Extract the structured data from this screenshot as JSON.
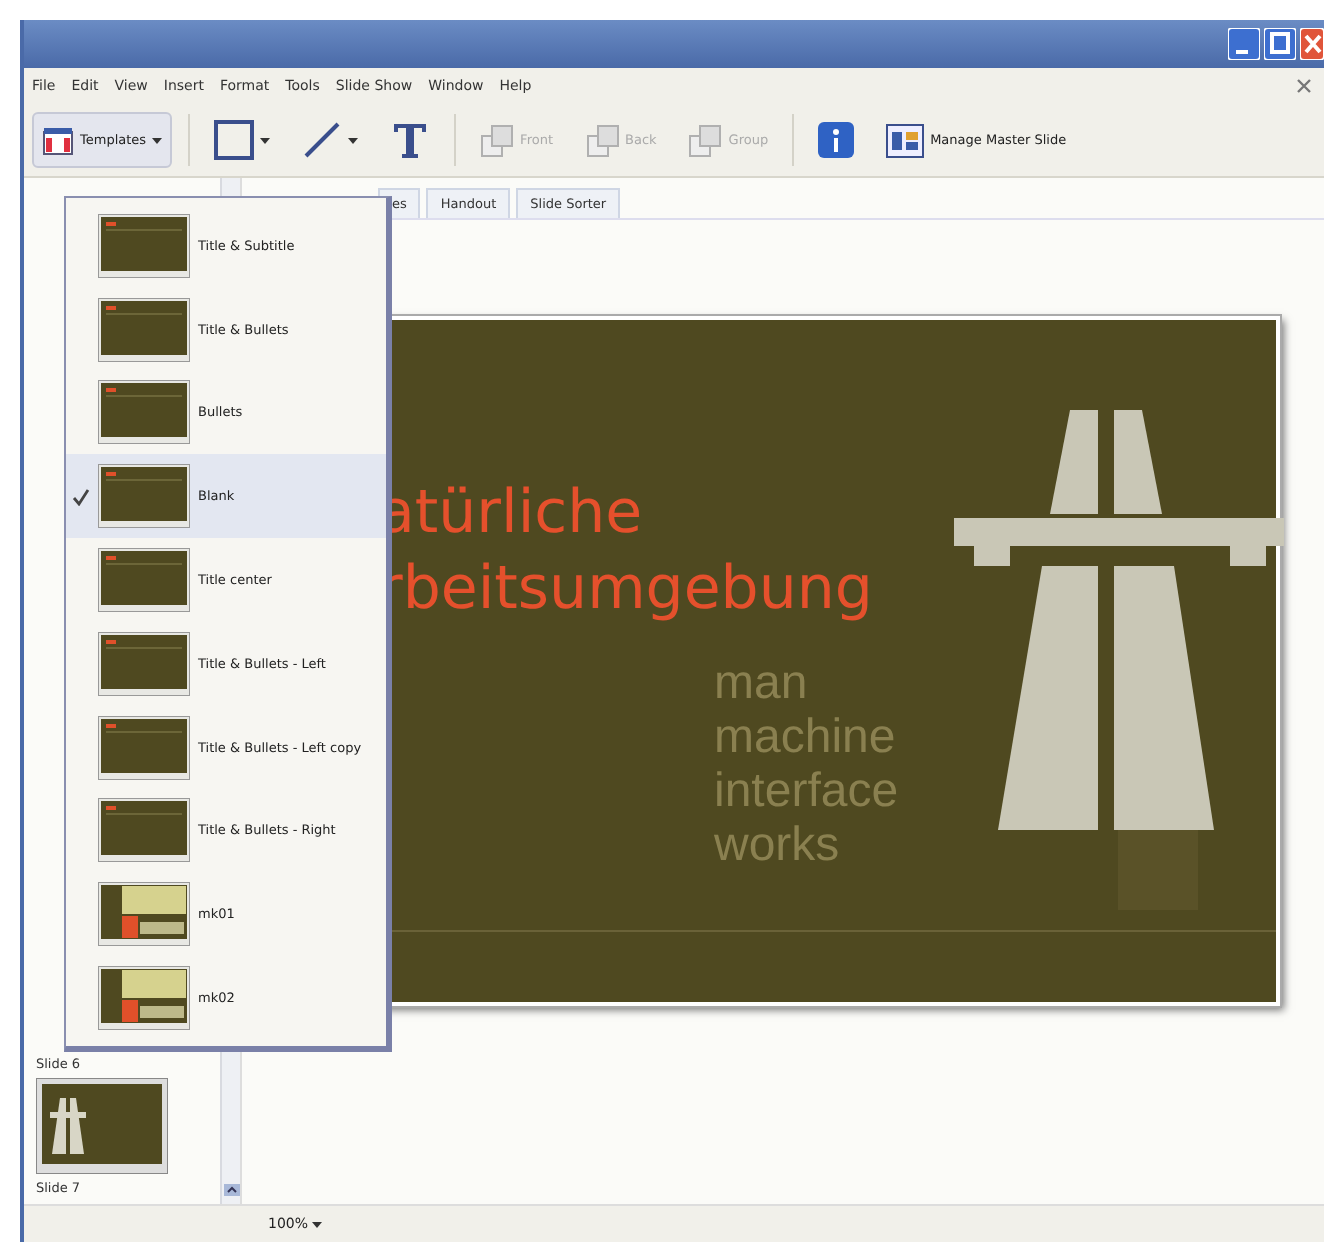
{
  "menu": [
    "File",
    "Edit",
    "View",
    "Insert",
    "Format",
    "Tools",
    "Slide Show",
    "Window",
    "Help"
  ],
  "toolbar": {
    "templates": "Templates",
    "tools": [
      {
        "kind": "rect"
      },
      {
        "kind": "line"
      },
      {
        "kind": "text"
      }
    ],
    "arrange": [
      {
        "label": "Front",
        "disabled": true
      },
      {
        "label": "Back",
        "disabled": true
      },
      {
        "label": "Group",
        "disabled": true
      }
    ],
    "master_button": "Manage Master Slide"
  },
  "tabs": [
    {
      "label": "es",
      "selected": false
    },
    {
      "label": "Handout",
      "selected": false
    },
    {
      "label": "Slide Sorter",
      "selected": false
    }
  ],
  "slide": {
    "title_lines": [
      "atürliche",
      "rbeitsumgebung"
    ],
    "background_words": [
      "man",
      "machine",
      "interface",
      "works"
    ]
  },
  "slide_panel": [
    {
      "label": "Slide 6",
      "kind": "label"
    },
    {
      "label": "Slide 7",
      "kind": "thumbnail"
    }
  ],
  "layouts": [
    {
      "label": "Title & Subtitle",
      "kind": "dark",
      "selected": false
    },
    {
      "label": "Title & Bullets",
      "kind": "dark",
      "selected": false
    },
    {
      "label": "Bullets",
      "kind": "dark",
      "selected": false
    },
    {
      "label": "Blank",
      "kind": "dark",
      "selected": true
    },
    {
      "label": "Title center",
      "kind": "dark",
      "selected": false
    },
    {
      "label": "Title & Bullets - Left",
      "kind": "dark",
      "selected": false
    },
    {
      "label": "Title & Bullets - Left copy",
      "kind": "dark",
      "selected": false
    },
    {
      "label": "Title & Bullets - Right",
      "kind": "dark",
      "selected": false
    },
    {
      "label": "mk01",
      "kind": "panel",
      "selected": false
    },
    {
      "label": "mk02",
      "kind": "panel",
      "selected": false
    }
  ],
  "status": {
    "zoom": "100%"
  }
}
